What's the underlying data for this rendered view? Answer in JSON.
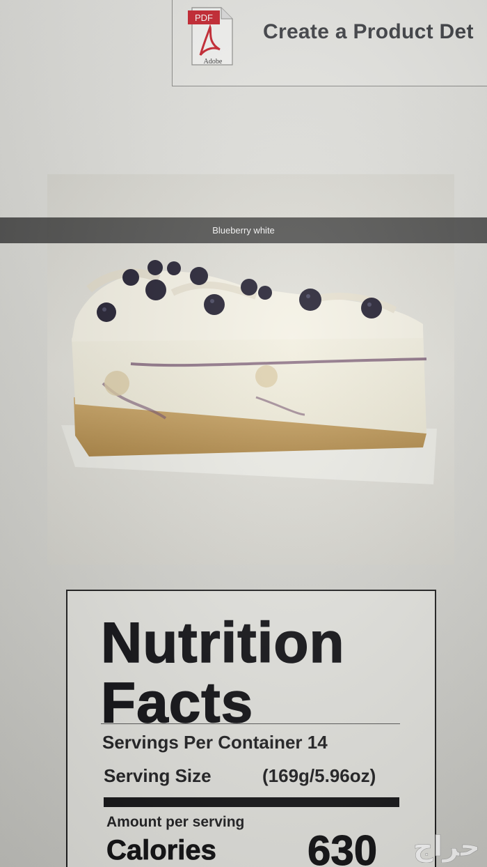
{
  "pdf_link": {
    "badge": "PDF",
    "vendor": "Adobe",
    "title": "Create a Product Det",
    "icon": "pdf-icon"
  },
  "photo": {
    "caption": "Blueberry white",
    "subject": "cheesecake-slice"
  },
  "nutrition": {
    "title_line1": "Nutrition",
    "title_line2": "Facts",
    "servings": "Servings Per Container 14",
    "serving_size_label": "Serving Size",
    "serving_size_value": "(169g/5.96oz)",
    "amount_per_serving": "Amount per serving",
    "calories_label": "Calories",
    "calories_value": "630"
  },
  "watermark": {
    "text": "حراج"
  },
  "colors": {
    "pdf_red": "#c8202b",
    "label_black": "#0c0c10",
    "caption_bg": "#282828"
  }
}
